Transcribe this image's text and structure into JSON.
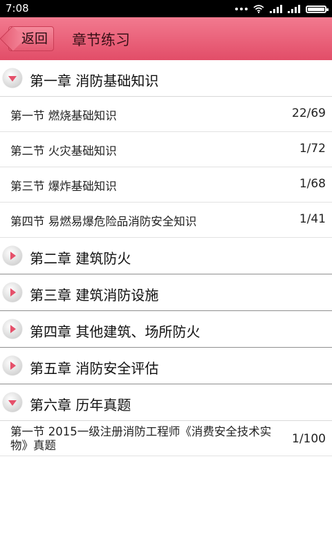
{
  "status_bar": {
    "time": "7:08"
  },
  "header": {
    "back_label": "返回",
    "title": "章节练习"
  },
  "colors": {
    "accent": "#e5506a",
    "header_top": "#f27a8f",
    "header_bottom": "#e24d68"
  },
  "chapters": [
    {
      "label": "第一章  消防基础知识",
      "expanded": true,
      "sections": [
        {
          "label": "第一节  燃烧基础知识",
          "count": "22/69"
        },
        {
          "label": "第二节  火灾基础知识",
          "count": "1/72"
        },
        {
          "label": "第三节  爆炸基础知识",
          "count": "1/68"
        },
        {
          "label": "第四节  易燃易爆危险品消防安全知识",
          "count": "1/41"
        }
      ]
    },
    {
      "label": "第二章  建筑防火",
      "expanded": false
    },
    {
      "label": "第三章  建筑消防设施",
      "expanded": false
    },
    {
      "label": "第四章  其他建筑、场所防火",
      "expanded": false
    },
    {
      "label": "第五章  消防安全评估",
      "expanded": false
    },
    {
      "label": "第六章  历年真题",
      "expanded": true,
      "sections": [
        {
          "label": "第一节  2015一级注册消防工程师《消费安全技术实物》真题",
          "count": "1/100"
        }
      ]
    }
  ]
}
